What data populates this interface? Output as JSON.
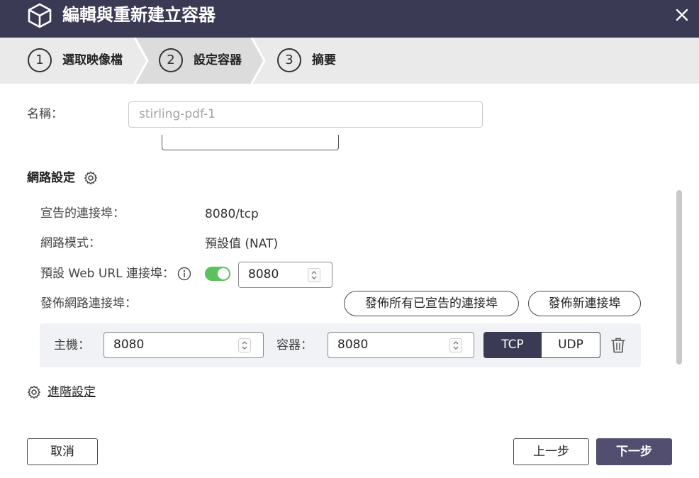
{
  "window": {
    "title": "編輯與重新建立容器",
    "icons": [
      "cube-icon",
      "close-icon"
    ]
  },
  "steps": [
    {
      "number": "1",
      "label": "選取映像檔"
    },
    {
      "number": "2",
      "label": "設定容器"
    },
    {
      "number": "3",
      "label": "摘要"
    }
  ],
  "name_field": {
    "label": "名稱：",
    "value": "stirling-pdf-1"
  },
  "network": {
    "section_title": "網路設定",
    "declared_ports_label": "宣告的連接埠：",
    "declared_ports_value": "8080/tcp",
    "mode_label": "網路模式：",
    "mode_value": "預設值 (NAT)",
    "web_url_port_label": "預設 Web URL 連接埠：",
    "web_url_port_enabled": true,
    "web_url_port_value": "8080",
    "publish_label": "發佈網路連接埠：",
    "publish_all_button": "發佈所有已宣告的連接埠",
    "publish_new_button": "發佈新連接埠",
    "port_mapping": {
      "host_label": "主機：",
      "host_value": "8080",
      "container_label": "容器：",
      "container_value": "8080",
      "protocols": [
        "TCP",
        "UDP"
      ],
      "selected_protocol": "TCP"
    }
  },
  "advanced_link": "進階設定",
  "footer": {
    "cancel": "取消",
    "prev": "上一步",
    "next": "下一步"
  },
  "colors": {
    "titlebar": "#3b3a54",
    "steps_bg": "#eaeaea",
    "active_step_bg": "#d9d9d9",
    "toggle_on": "#5cc15f",
    "primary_button": "#514e6f",
    "port_row_bg": "#f1f2f5"
  }
}
